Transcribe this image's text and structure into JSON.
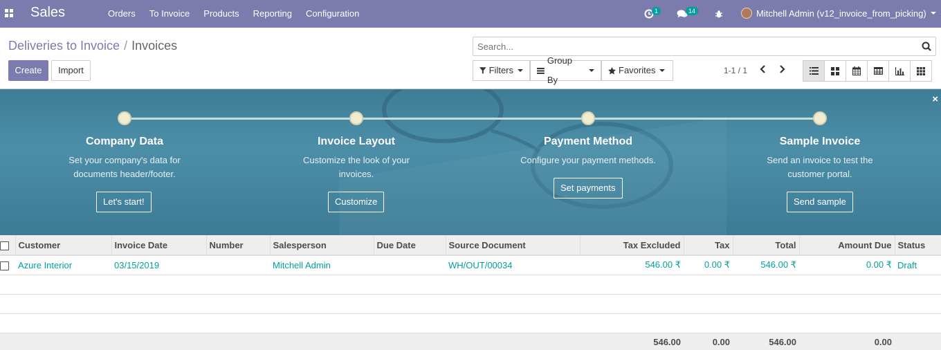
{
  "navbar": {
    "brand": "Sales",
    "menu": [
      "Orders",
      "To Invoice",
      "Products",
      "Reporting",
      "Configuration"
    ],
    "activity_badge": "1",
    "messages_badge": "14",
    "user_label": "Mitchell Admin (v12_invoice_from_picking)"
  },
  "breadcrumb": {
    "parent": "Deliveries to Invoice",
    "separator": "/",
    "current": "Invoices"
  },
  "buttons": {
    "create": "Create",
    "import": "Import"
  },
  "search": {
    "placeholder": "Search..."
  },
  "filters": {
    "filters": "Filters",
    "group_by": "Group By",
    "favorites": "Favorites"
  },
  "pager": {
    "value": "1-1 / 1"
  },
  "onboarding": {
    "steps": [
      {
        "title": "Company Data",
        "description": "Set your company's data for documents header/footer.",
        "button": "Let's start!"
      },
      {
        "title": "Invoice Layout",
        "description": "Customize the look of your invoices.",
        "button": "Customize"
      },
      {
        "title": "Payment Method",
        "description": "Configure your payment methods.",
        "button": "Set payments"
      },
      {
        "title": "Sample Invoice",
        "description": "Send an invoice to test the customer portal.",
        "button": "Send sample"
      }
    ]
  },
  "table": {
    "headers": [
      "Customer",
      "Invoice Date",
      "Number",
      "Salesperson",
      "Due Date",
      "Source Document",
      "Tax Excluded",
      "Tax",
      "Total",
      "Amount Due",
      "Status"
    ],
    "rows": [
      [
        "Azure Interior",
        "03/15/2019",
        "",
        "Mitchell Admin",
        "",
        "WH/OUT/00034",
        "546.00 ₹",
        "0.00 ₹",
        "546.00 ₹",
        "0.00 ₹",
        "Draft"
      ]
    ],
    "totals": {
      "tax_excluded": "546.00",
      "tax": "0.00",
      "total": "546.00",
      "amount_due": "0.00"
    }
  },
  "colors": {
    "navbar": "#7c7bad",
    "link": "#00a09d",
    "banner": "#4c8ea8"
  }
}
